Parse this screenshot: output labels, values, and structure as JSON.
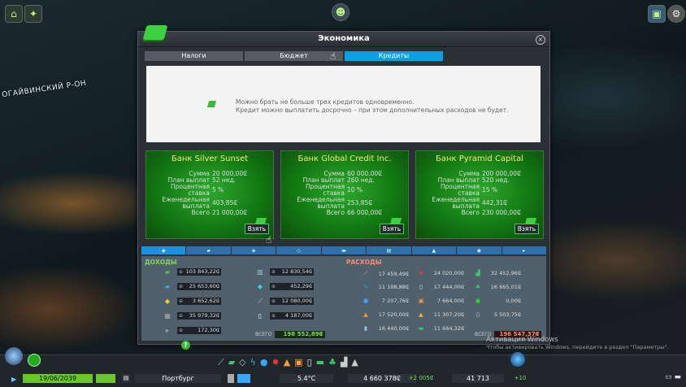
{
  "district_label": "ОГАЙВИНСКИЙ Р-ОН",
  "panel": {
    "title": "Экономика",
    "tabs": [
      "Налоги",
      "Бюджет",
      "Кредиты"
    ],
    "active_tab": 2,
    "info_lines": [
      "Можно брать не больше трех кредитов одновременно.",
      "Кредит можно выплатить досрочно – при этом дополнительных расходов не будет."
    ],
    "field_labels": [
      "Сумма",
      "План выплат",
      "Процентная ставка",
      "Еженедельная выплата",
      "Всего"
    ],
    "take_label": "Взять",
    "banks": [
      {
        "name": "Банк Silver Sunset",
        "values": [
          "20 000,00₢",
          "52 нед.",
          "5 %",
          "403,85₢",
          "21 000,00₢"
        ]
      },
      {
        "name": "Банк Global Credit Inc.",
        "values": [
          "60 000,00₢",
          "260 нед.",
          "10 %",
          "253,85₢",
          "66 000,00₢"
        ]
      },
      {
        "name": "Банк Pyramid Capital",
        "values": [
          "200 000,00₢",
          "520 нед.",
          "15 %",
          "442,31₢",
          "230 000,00₢"
        ]
      }
    ],
    "income": {
      "label": "ДОХОДЫ",
      "left_values": [
        "103 843,22₢",
        "25 653,60₢",
        "3 652,62₢",
        "35 979,32₢",
        "172,30₢"
      ],
      "right_values": [
        "12 830,54₢",
        "452,29₢",
        "12 080,00₢",
        "4 187,00₢"
      ],
      "total_label": "ВСЕГО",
      "total_value": "198 552,89₢"
    },
    "expenses": {
      "label": "РАСХОДЫ",
      "col1": [
        "17 459,49₢",
        "11 198,88₢",
        "7 207,76₢",
        "17 520,00₢",
        "16 440,00₢"
      ],
      "col2": [
        "24 020,00₢",
        "17 444,00₢",
        "7 664,00₢",
        "11 307,20₢",
        "11 664,32₢"
      ],
      "col3": [
        "32 452,96₢",
        "16 665,01₢",
        "0,00₢",
        "5 503,75₢"
      ],
      "total_label": "ВСЕГО",
      "total_value": "196 547,37₢"
    },
    "colors": {
      "accent": "#0aa0e6",
      "bank_title": "#f7e87a",
      "income": "#7ed957",
      "expense": "#ff8a6a"
    }
  },
  "bottom_bar": {
    "date": "19/06/2039",
    "city": "Портбург",
    "temperature": "5.4°C",
    "money": "4 660 378₢",
    "income_rate": "+2 005₢",
    "population": "41 713",
    "pop_change": "+10"
  },
  "watermark": {
    "line1": "Активация Windows",
    "line2": "Чтобы активировать Windows, перейдите в раздел \"Параметры\"."
  }
}
